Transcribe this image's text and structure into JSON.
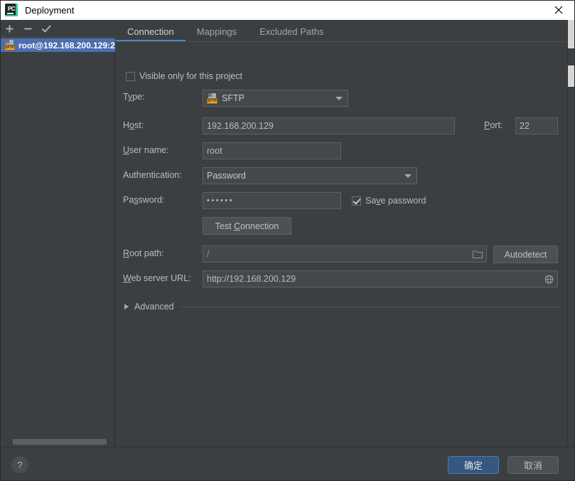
{
  "window": {
    "title": "Deployment",
    "app_icon": "pycharm-icon",
    "close_icon": "close-icon"
  },
  "sidebar": {
    "toolbar": [
      {
        "name": "add",
        "icon": "plus-icon"
      },
      {
        "name": "remove",
        "icon": "minus-icon"
      },
      {
        "name": "set-default",
        "icon": "check-icon"
      }
    ],
    "items": [
      {
        "label": "root@192.168.200.129:2",
        "icon": "sftp-icon",
        "selected": true
      }
    ]
  },
  "tabs": [
    {
      "label": "Connection",
      "active": true
    },
    {
      "label": "Mappings",
      "active": false
    },
    {
      "label": "Excluded Paths",
      "active": false
    }
  ],
  "form": {
    "visible_only": {
      "label_pre": "Visible only for this project",
      "checked": false
    },
    "type": {
      "label_pre": "T",
      "label_key": "y",
      "label_post": "pe:",
      "value": "SFTP",
      "icon": "sftp-icon",
      "badge": "SFTP"
    },
    "host": {
      "label_pre": "H",
      "label_key": "o",
      "label_post": "st:",
      "value": "192.168.200.129"
    },
    "port": {
      "label_pre": "",
      "label_key": "P",
      "label_post": "ort:",
      "value": "22"
    },
    "username": {
      "label_pre": "",
      "label_key": "U",
      "label_post": "ser name:",
      "value": "root"
    },
    "authentication": {
      "label": "Authentication:",
      "value": "Password"
    },
    "password": {
      "label_pre": "Pa",
      "label_key": "s",
      "label_post": "sword:",
      "value": "••••••"
    },
    "save_password": {
      "label_pre": "Sa",
      "label_key": "v",
      "label_post": "e password",
      "checked": true
    },
    "test_connection": {
      "label_pre": "Test ",
      "label_key": "C",
      "label_post": "onnection"
    },
    "root_path": {
      "label_pre": "",
      "label_key": "R",
      "label_post": "oot path:",
      "value": "/",
      "browse_icon": "folder-icon"
    },
    "autodetect": {
      "label": "Autodetect"
    },
    "web_server_url": {
      "label_pre": "",
      "label_key": "W",
      "label_post": "eb server URL:",
      "value": "http://192.168.200.129",
      "open_icon": "globe-icon"
    },
    "advanced": {
      "label": "Advanced",
      "expanded": false
    }
  },
  "footer": {
    "help": "?",
    "ok": "确定",
    "cancel": "取消"
  },
  "colors": {
    "background": "#3c3f41",
    "titlebar": "#ffffff",
    "accent": "#4a88c7",
    "selection": "#4b6eaf",
    "ok_button": "#365880",
    "text": "#bbbbbb",
    "sftp_badge": "#e8a33d"
  }
}
